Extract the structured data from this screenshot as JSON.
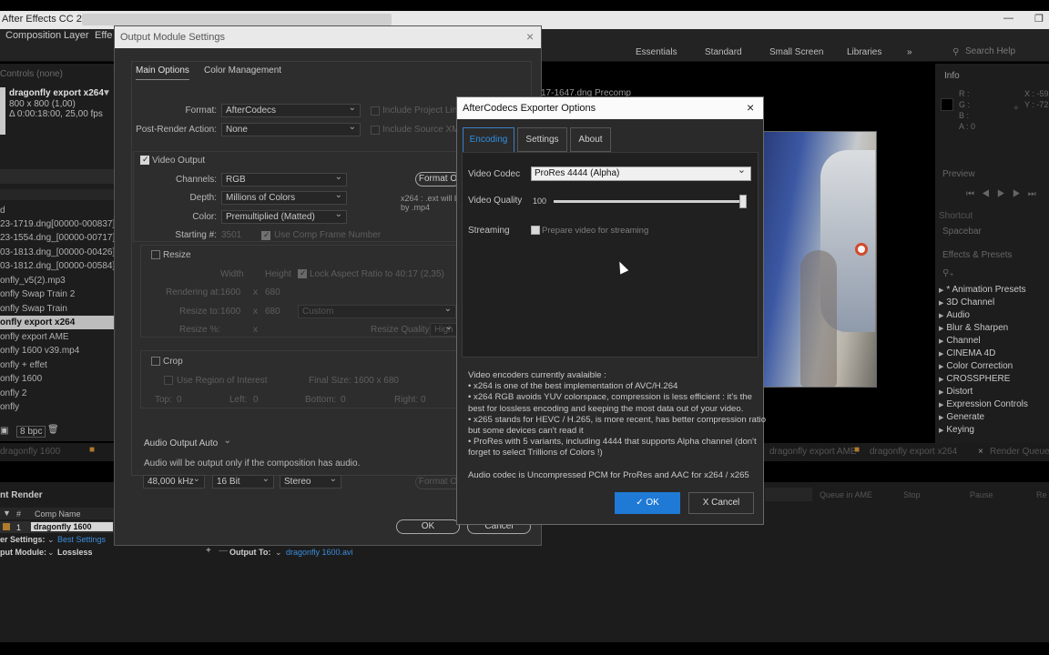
{
  "app": {
    "title": "After Effects CC 2017"
  },
  "menu": [
    "Composition",
    "Layer",
    "Effe"
  ],
  "workspaces": [
    "Essentials",
    "Standard",
    "Small Screen",
    "Libraries"
  ],
  "search_placeholder": "Search Help",
  "project": {
    "header": "Controls (none)",
    "comp_name": "dragonfly export x264",
    "comp_size": "800 x 800 (1,00)",
    "comp_duration": "Δ 0:00:18:00, 25,00 fps",
    "items": [
      "d",
      "23-1719.dng[00000-000837].jp",
      "23-1554.dng_[00000-00717].jp",
      "03-1813.dng_[00000-00426].jpg",
      "03-1812.dng_[00000-00584].jp",
      "onfly_v5(2).mp3",
      "onfly Swap Train 2",
      "onfly Swap Train",
      "onfly export x264",
      "onfly export AME",
      "onfly 1600 v39.mp4",
      "onfly + effet",
      "onfly 1600",
      "onfly 2",
      "onfly"
    ],
    "selected_index": 8,
    "bpc": "8 bpc"
  },
  "comp_viewer": {
    "tab": "17-1647.dng Precomp"
  },
  "info_panel": {
    "title": "Info",
    "r": "R :",
    "g": "G :",
    "b": "B :",
    "a": "A : 0",
    "x": "X : -59",
    "y": "Y : -72"
  },
  "preview_panel": {
    "title": "Preview"
  },
  "shortcut": {
    "label": "Shortcut",
    "value": "Spacebar"
  },
  "effects_presets": {
    "title": "Effects & Presets",
    "items": [
      "* Animation Presets",
      "3D Channel",
      "Audio",
      "Blur & Sharpen",
      "Channel",
      "CINEMA 4D",
      "Color Correction",
      "CROSSPHERE",
      "Distort",
      "Expression Controls",
      "Generate",
      "Keying"
    ]
  },
  "bottom_tabs": [
    "dragonfly 1600",
    "dragonfly export AME",
    "dragonfly export x264",
    "Render Queue"
  ],
  "render_queue": {
    "title": "nt Render",
    "col_num": "#",
    "col_comp": "Comp Name",
    "row_num": "1",
    "row_comp": "dragonfly 1600",
    "render_settings_label": "er Settings:",
    "render_settings_value": "Best Settings",
    "output_module_label": "put Module:",
    "output_module_value": "Lossless",
    "output_to_label": "Output To:",
    "output_to_value": "dragonfly 1600.avi",
    "queue_in_ame": "Queue in AME",
    "stop": "Stop",
    "pause": "Pause",
    "render": "Re"
  },
  "output_module": {
    "title": "Output Module Settings",
    "tabs": [
      "Main Options",
      "Color Management"
    ],
    "format_label": "Format:",
    "format_value": "AfterCodecs",
    "include_project_link": "Include Project Link",
    "post_render_label": "Post-Render Action:",
    "post_render_value": "None",
    "include_source_xmp": "Include Source XMP M",
    "video_output": "Video Output",
    "channels_label": "Channels:",
    "channels_value": "RGB",
    "depth_label": "Depth:",
    "depth_value": "Millions of Colors",
    "color_label": "Color:",
    "color_value": "Premultiplied (Matted)",
    "starting_label": "Starting #:",
    "starting_value": "3501",
    "use_comp_frame": "Use Comp Frame Number",
    "format_options": "Format O",
    "format_note_1": "x264 : .ext will be r",
    "format_note_2": "by .mp4",
    "resize": "Resize",
    "width": "Width",
    "height": "Height",
    "lock_aspect": "Lock Aspect Ratio to 40:17 (2,35)",
    "rendering_at": "Rendering at:",
    "rendering_w": "1600",
    "rendering_x": "x",
    "rendering_h": "680",
    "resize_to": "Resize to:",
    "resize_w": "1600",
    "resize_h": "680",
    "custom": "Custom",
    "resize_pct": "Resize %:",
    "resize_pct_x": "x",
    "resize_quality": "Resize Quality:",
    "resize_quality_value": "High",
    "crop": "Crop",
    "use_roi": "Use Region of Interest",
    "final_size": "Final Size: 1600 x 680",
    "top": "Top:",
    "top_v": "0",
    "left": "Left:",
    "left_v": "0",
    "bottom": "Bottom:",
    "bottom_v": "0",
    "right": "Right:",
    "right_v": "0",
    "audio_output": "Audio Output Auto",
    "audio_note": "Audio will be output only if the composition has audio.",
    "sample_rate": "48,000 kHz",
    "bit_depth": "16 Bit",
    "channels_audio": "Stereo",
    "format_options2": "Format O",
    "ok": "OK",
    "cancel": "Cancel"
  },
  "aftercodecs": {
    "title": "AfterCodecs Exporter Options",
    "tabs": [
      "Encoding",
      "Settings",
      "About"
    ],
    "video_codec_label": "Video Codec",
    "video_codec_value": "ProRes 4444 (Alpha)",
    "video_quality_label": "Video Quality",
    "video_quality_value": "100",
    "streaming_label": "Streaming",
    "streaming_checkbox": "Prepare video for streaming",
    "info_lines": [
      "Video encoders currently avalaible :",
      " • x264 is one of the best implementation of AVC/H.264",
      " • x264 RGB avoids YUV colorspace, compression is less efficient : it's the",
      "best for lossless encoding and keeping the most data out of your video.",
      " • x265 stands for HEVC / H.265, is more recent, has better compression ratio",
      " but some devices can't read it",
      " • ProRes with 5 variants, including 4444 that supports Alpha channel (don't",
      " forget to select Trillions of Colors !)",
      "",
      "Audio codec is Uncompressed PCM for ProRes and AAC for x264 / x265"
    ],
    "ok_label": "✓ OK",
    "cancel_label": "X Cancel"
  }
}
